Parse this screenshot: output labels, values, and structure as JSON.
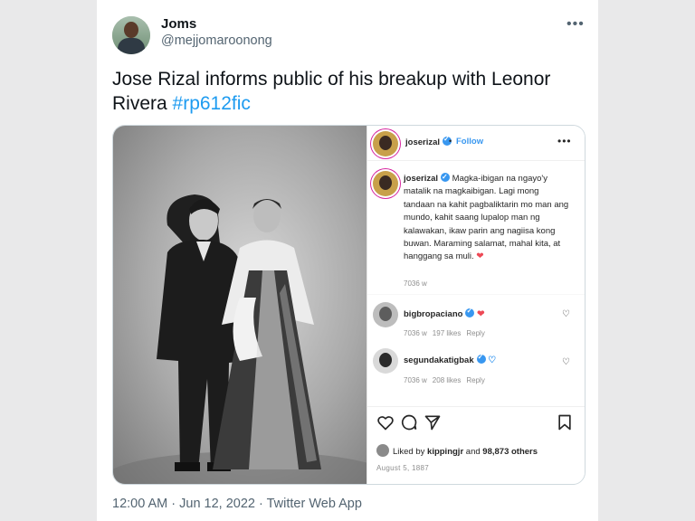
{
  "tweet": {
    "display_name": "Joms",
    "handle": "@mejjomaroonong",
    "more_icon": "more-icon",
    "text": "Jose Rizal informs public of his breakup with Leonor Rivera",
    "hashtag": "#rp612fic",
    "hashtag_color": "#1d9bf0",
    "footer": "12:00 AM · Jun 12, 2022 · Twitter Web App"
  },
  "instagram": {
    "header": {
      "username": "joserizal",
      "separator": "•",
      "follow_label": "Follow",
      "more_icon": "ellipsis-icon"
    },
    "caption": {
      "username": "joserizal",
      "text": "Magka-ibigan na ngayo'y matalik na magkaibigan. Lagi mong tandaan na kahit pagbaliktarin mo man ang mundo, kahit saang lupalop man ng kalawakan, ikaw parin ang nagiisa kong buwan. Maraming salamat, mahal kita, at hanggang sa muli.",
      "heart": "❤",
      "time": "7036 w"
    },
    "comments": [
      {
        "username": "bigbropaciano",
        "time": "7036 w",
        "likes": "197 likes",
        "reply": "Reply",
        "heart": "❤"
      },
      {
        "username": "segundakatigbak",
        "time": "7036 w",
        "likes": "208 likes",
        "reply": "Reply",
        "heart": "♡"
      }
    ],
    "like_glyph": "♡",
    "actions": [
      "heart-icon",
      "comment-icon",
      "share-icon",
      "bookmark-icon"
    ],
    "likes": {
      "prefix": "Liked by",
      "user": "kippingjr",
      "and": "and",
      "count": "98,873 others"
    },
    "date": "August 5, 1887",
    "accent": "#3897f0",
    "heart_color": "#ed4956"
  }
}
